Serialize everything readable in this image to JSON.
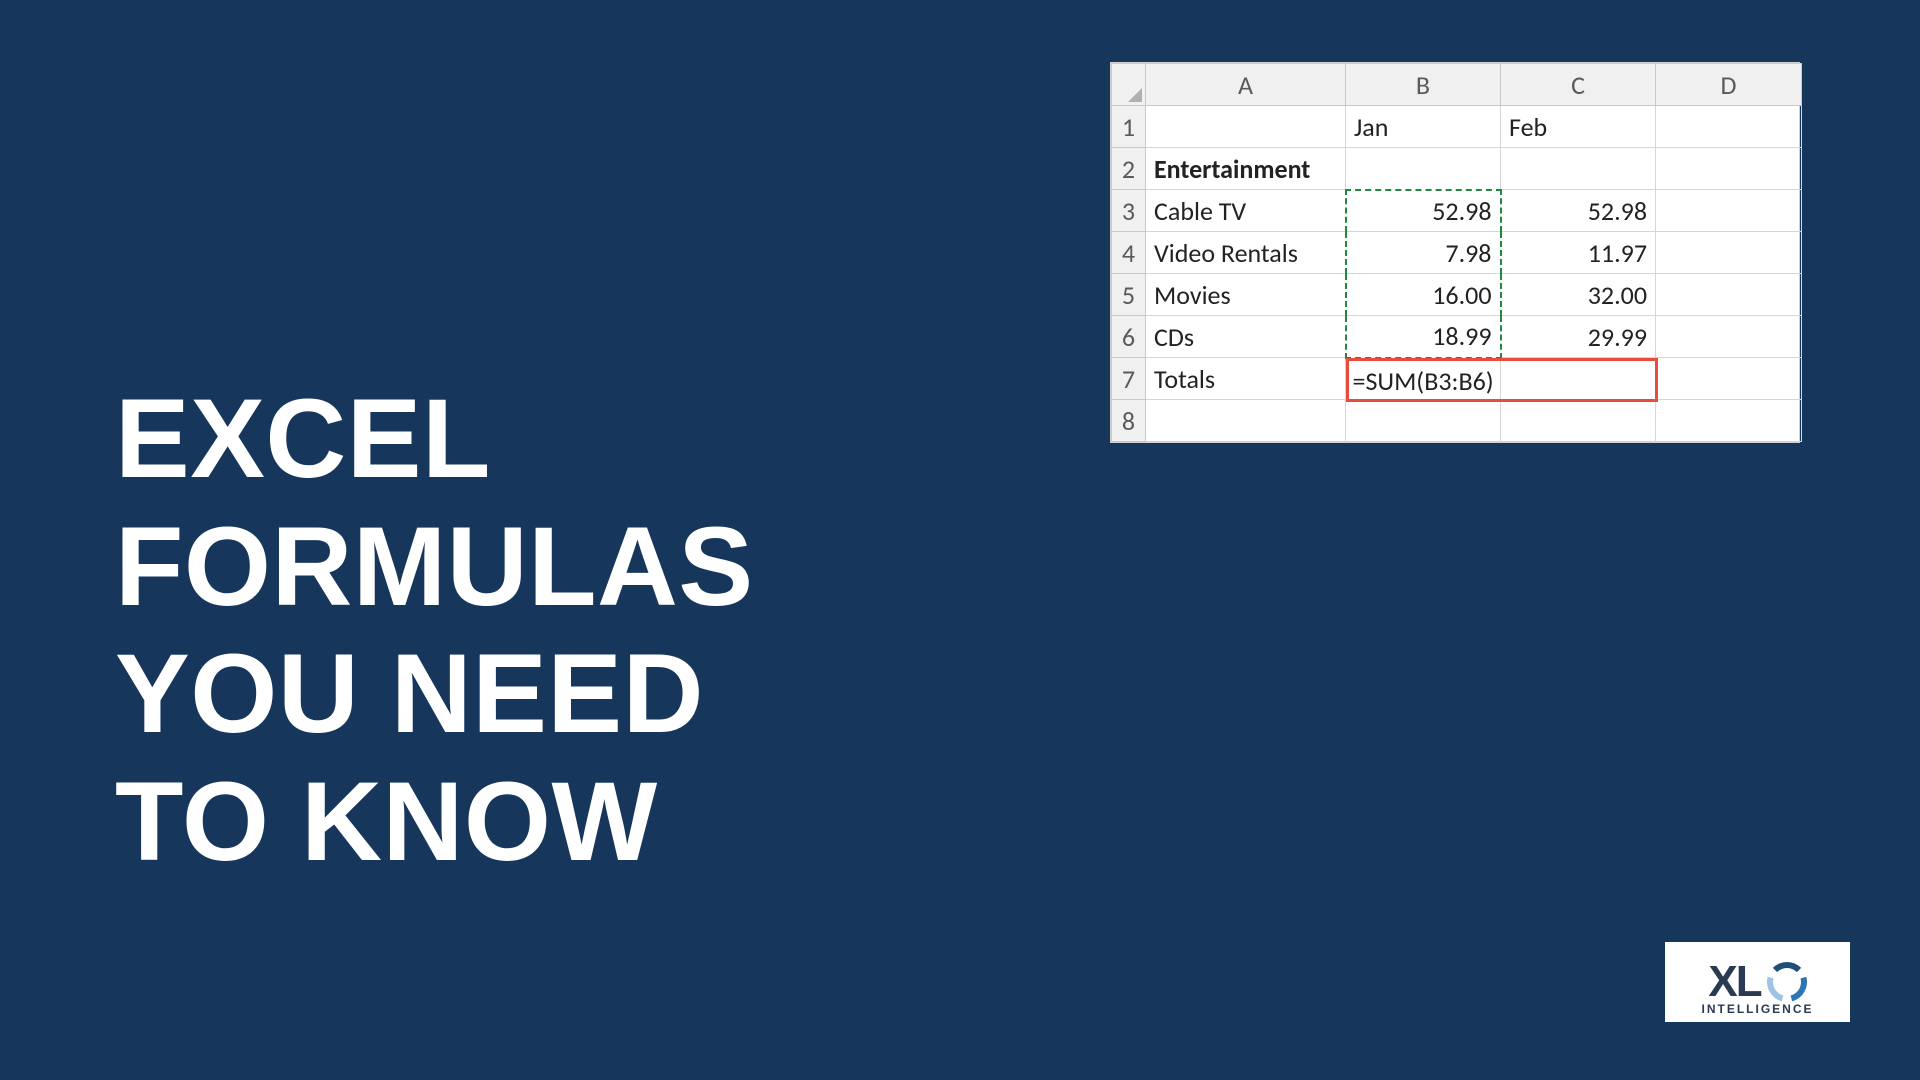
{
  "title_lines": [
    "EXCEL",
    "FORMULAS",
    "YOU NEED",
    "TO KNOW"
  ],
  "sheet": {
    "col_letters": [
      "A",
      "B",
      "C",
      "D"
    ],
    "row_numbers": [
      "1",
      "2",
      "3",
      "4",
      "5",
      "6",
      "7",
      "8"
    ],
    "header_row": {
      "B": "Jan",
      "C": "Feb"
    },
    "section_label": "Entertainment",
    "rows": [
      {
        "label": "Cable TV",
        "B": "52.98",
        "C": "52.98"
      },
      {
        "label": "Video Rentals",
        "B": "7.98",
        "C": "11.97"
      },
      {
        "label": "Movies",
        "B": "16.00",
        "C": "32.00"
      },
      {
        "label": "CDs",
        "B": "18.99",
        "C": "29.99"
      }
    ],
    "totals_label": "Totals",
    "formula_text": "=SUM(B3:B6)"
  },
  "logo": {
    "text": "XL",
    "sub": "INTELLIGENCE"
  },
  "colors": {
    "bg": "#16365c",
    "accent_red": "#e74c3c",
    "accent_green": "#1f8a3b"
  }
}
